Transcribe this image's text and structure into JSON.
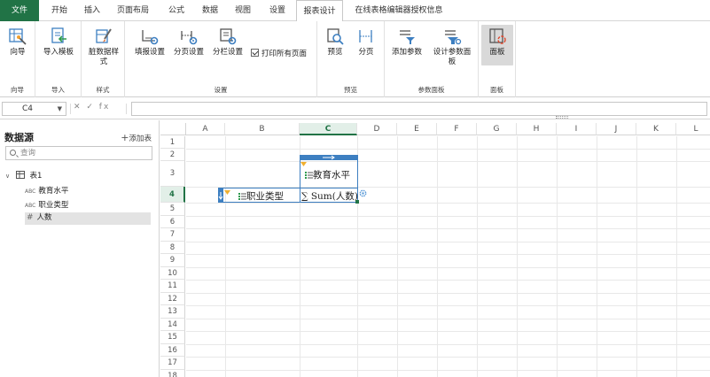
{
  "tabs": [
    "文件",
    "开始",
    "插入",
    "页面布局",
    "公式",
    "数据",
    "视图",
    "设置",
    "报表设计",
    "在线表格编辑器授权信息"
  ],
  "ribbon": {
    "groups": [
      {
        "label": "向导",
        "buttons": [
          "向导"
        ]
      },
      {
        "label": "导入",
        "buttons": [
          "导入模板"
        ]
      },
      {
        "label": "样式",
        "buttons": [
          "脏数据样式"
        ]
      },
      {
        "label": "设置",
        "buttons": [
          "填报设置",
          "分页设置",
          "分栏设置"
        ],
        "checkbox": "打印所有页面"
      },
      {
        "label": "预览",
        "buttons": [
          "预览",
          "分页"
        ]
      },
      {
        "label": "参数面板",
        "buttons": [
          "添加参数",
          "设计参数面板"
        ]
      },
      {
        "label": "面板",
        "buttons": [
          "面板"
        ]
      }
    ]
  },
  "formula_bar": {
    "cell_ref": "C4",
    "buttons": "✕ ✓ fx",
    "formula": ""
  },
  "sidebar": {
    "title": "数据源",
    "add_table": "添加表",
    "search_placeholder": "查询",
    "table_name": "表1",
    "fields": [
      {
        "type": "ABC",
        "name": "教育水平"
      },
      {
        "type": "ABC",
        "name": "职业类型"
      },
      {
        "type": "#",
        "name": "人数"
      }
    ]
  },
  "sheet": {
    "columns": [
      "A",
      "B",
      "C",
      "D",
      "E",
      "F",
      "G",
      "H",
      "I",
      "J",
      "K",
      "L"
    ],
    "rows": [
      "1",
      "2",
      "3",
      "4",
      "5",
      "6",
      "7",
      "8",
      "9",
      "10",
      "11",
      "12",
      "13",
      "14",
      "15",
      "16",
      "17",
      "18"
    ],
    "selected_col": "C",
    "selected_row": "4",
    "cells": {
      "c3": "教育水平",
      "b4": "职业类型",
      "c4": "∑ Sum(人数)"
    }
  },
  "colors": {
    "accent": "#217346",
    "pivot_blue": "#3d7fc1"
  }
}
